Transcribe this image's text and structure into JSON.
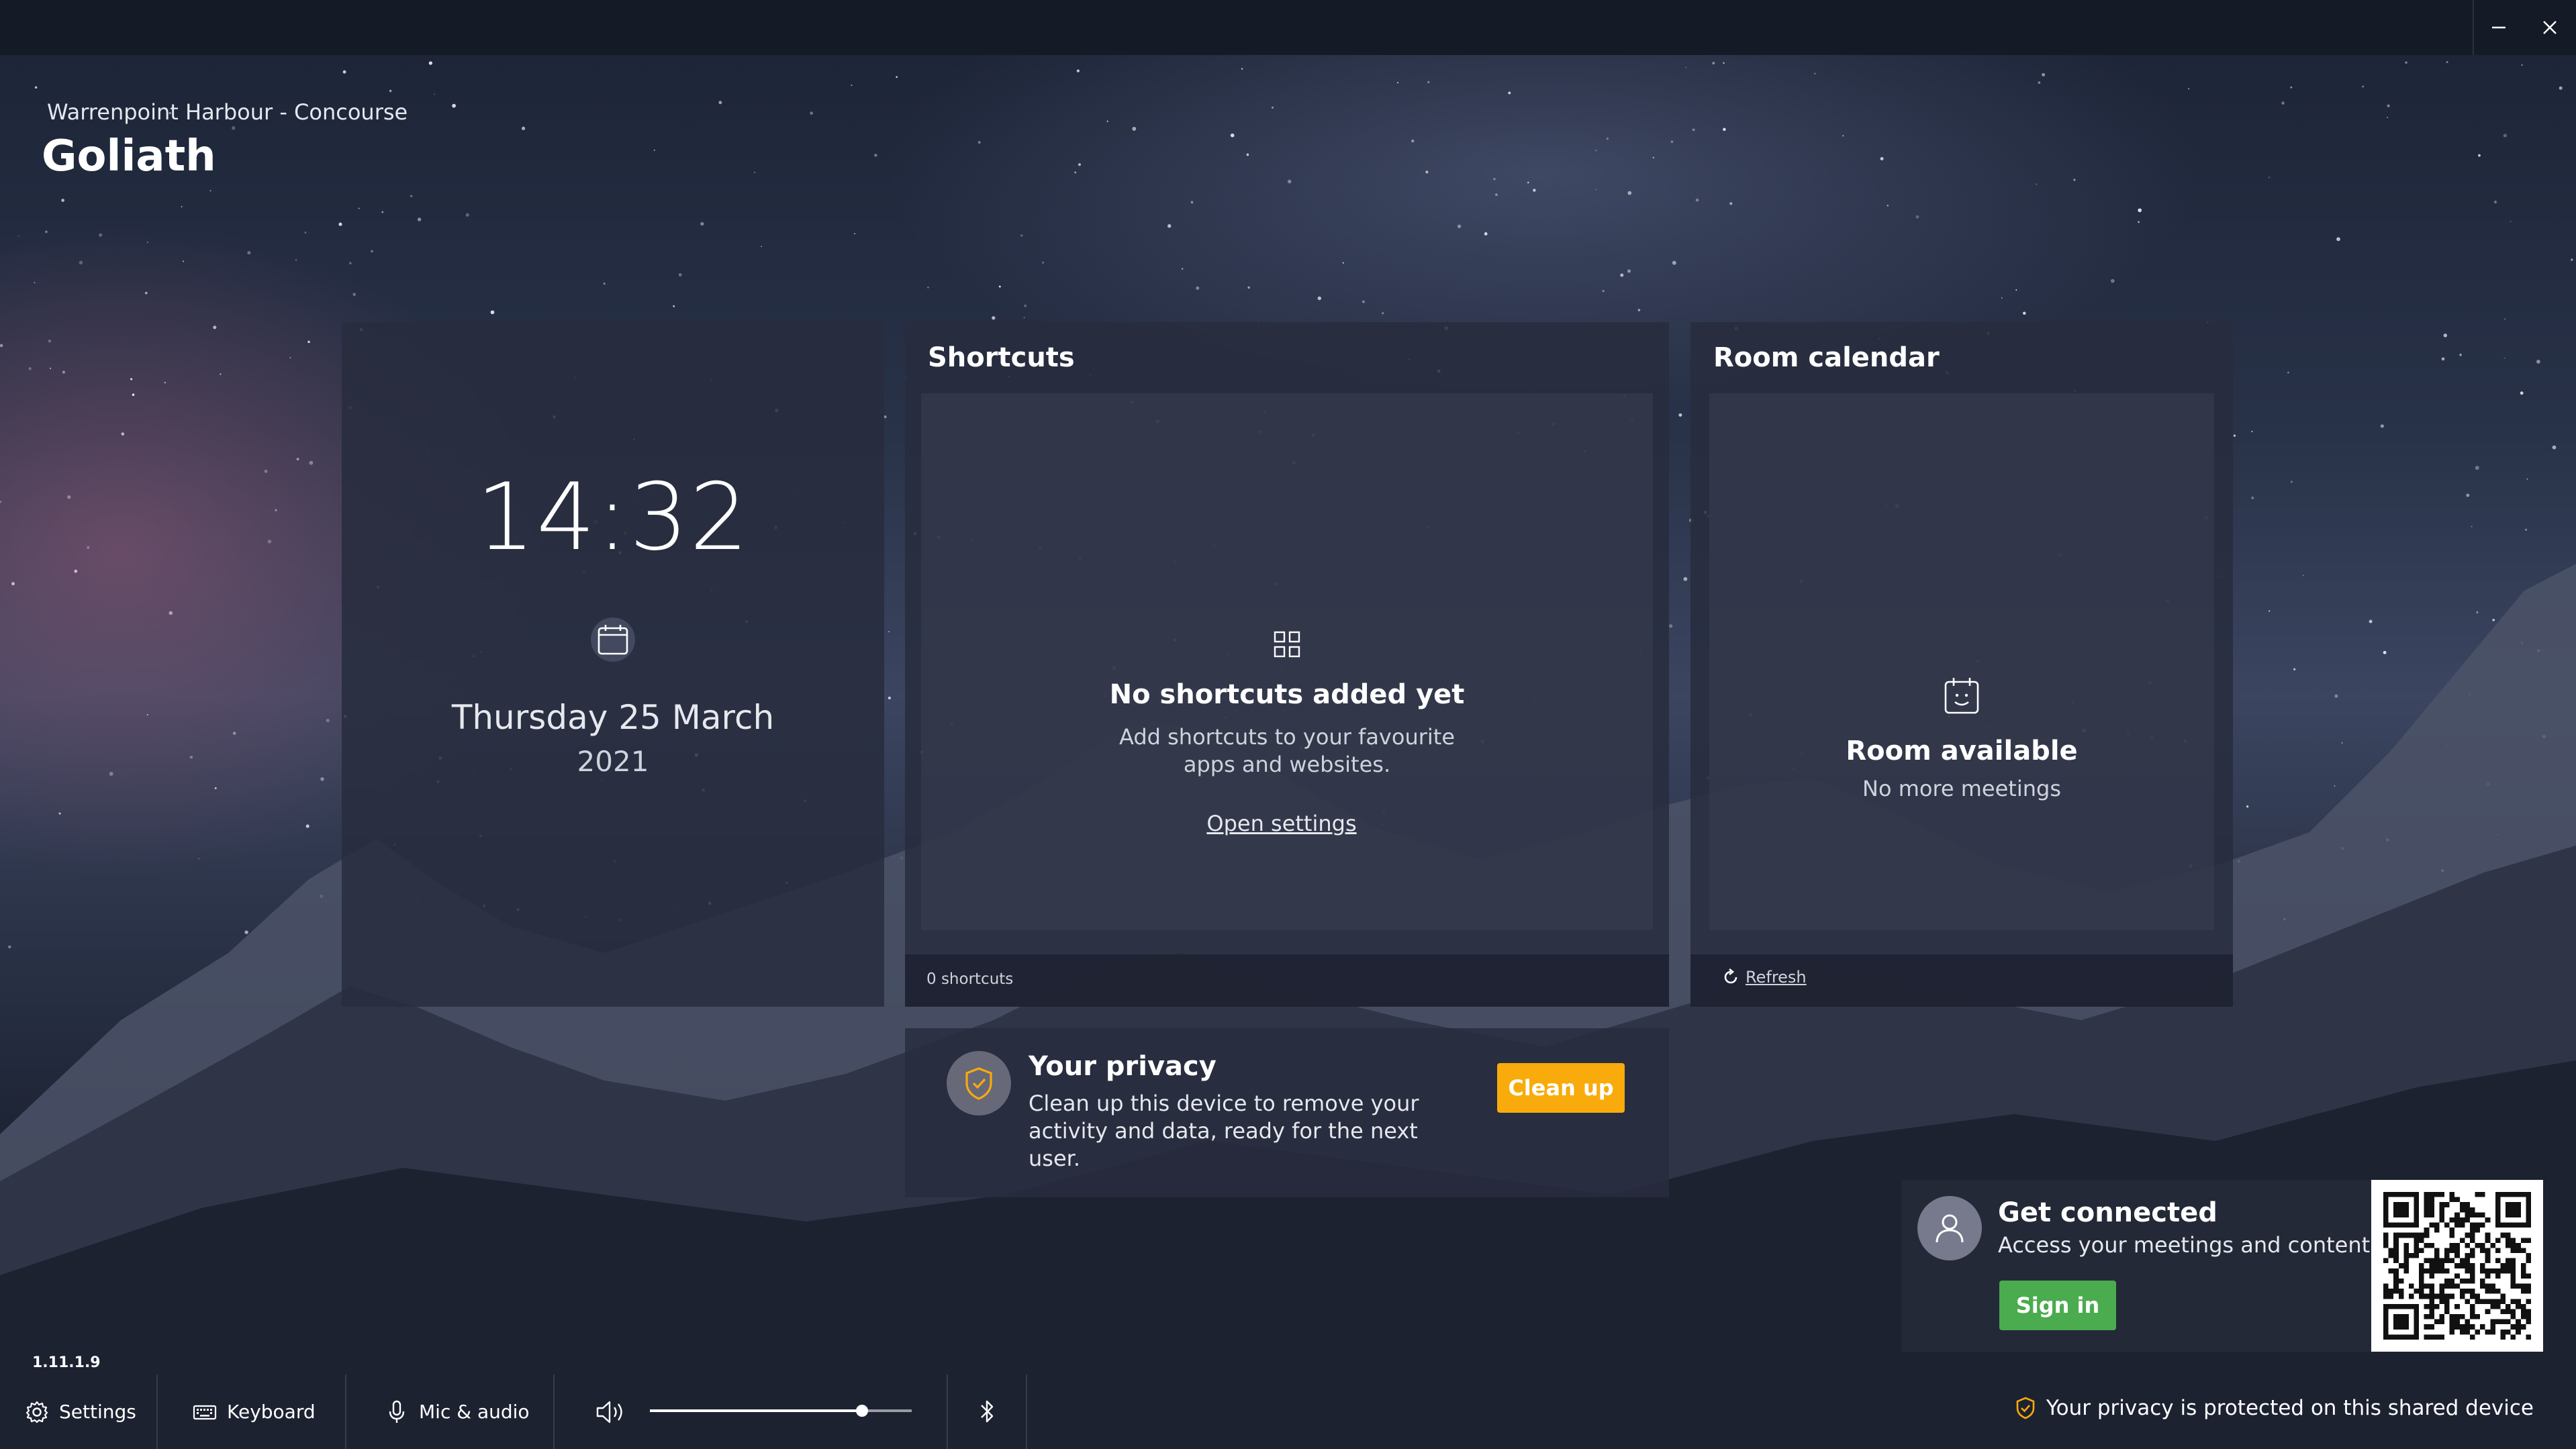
{
  "window": {
    "controls": [
      {
        "name": "minimize-icon"
      },
      {
        "name": "close-icon"
      }
    ]
  },
  "header": {
    "location": "Warrenpoint Harbour - Concourse",
    "room_name": "Goliath"
  },
  "clock_widget": {
    "time": "14:32",
    "date": "Thursday 25 March",
    "year": "2021",
    "icon": "calendar-icon"
  },
  "shortcuts": {
    "title": "Shortcuts",
    "empty_title": "No shortcuts added yet",
    "empty_description": "Add shortcuts to your favourite apps and websites.",
    "open_settings_label": "Open settings",
    "count_label": "0 shortcuts",
    "icon": "grid-icon"
  },
  "room_calendar": {
    "title": "Room calendar",
    "status": "Room available",
    "subtitle": "No more meetings",
    "refresh_label": "Refresh",
    "icon": "calendar-smile-icon"
  },
  "privacy_card": {
    "title": "Your privacy",
    "description": "Clean up this device to remove your activity and data, ready for the next user.",
    "cleanup_label": "Clean up",
    "icon": "shield-check-icon"
  },
  "connect_card": {
    "title": "Get connected",
    "description": "Access your meetings and content.",
    "signin_label": "Sign in",
    "qr_icon": "qr-code-icon"
  },
  "version": "1.11.1.9",
  "taskbar": {
    "settings_label": "Settings",
    "keyboard_label": "Keyboard",
    "mic_label": "Mic & audio",
    "volume_level": 0.81,
    "privacy_note": "Your privacy is protected on this shared device"
  },
  "colors": {
    "accent_orange": "#f8ab0a",
    "signin_green": "#4bab4f",
    "shield_orange": "#f8ab0a",
    "panel_bg": "#282c3e"
  }
}
